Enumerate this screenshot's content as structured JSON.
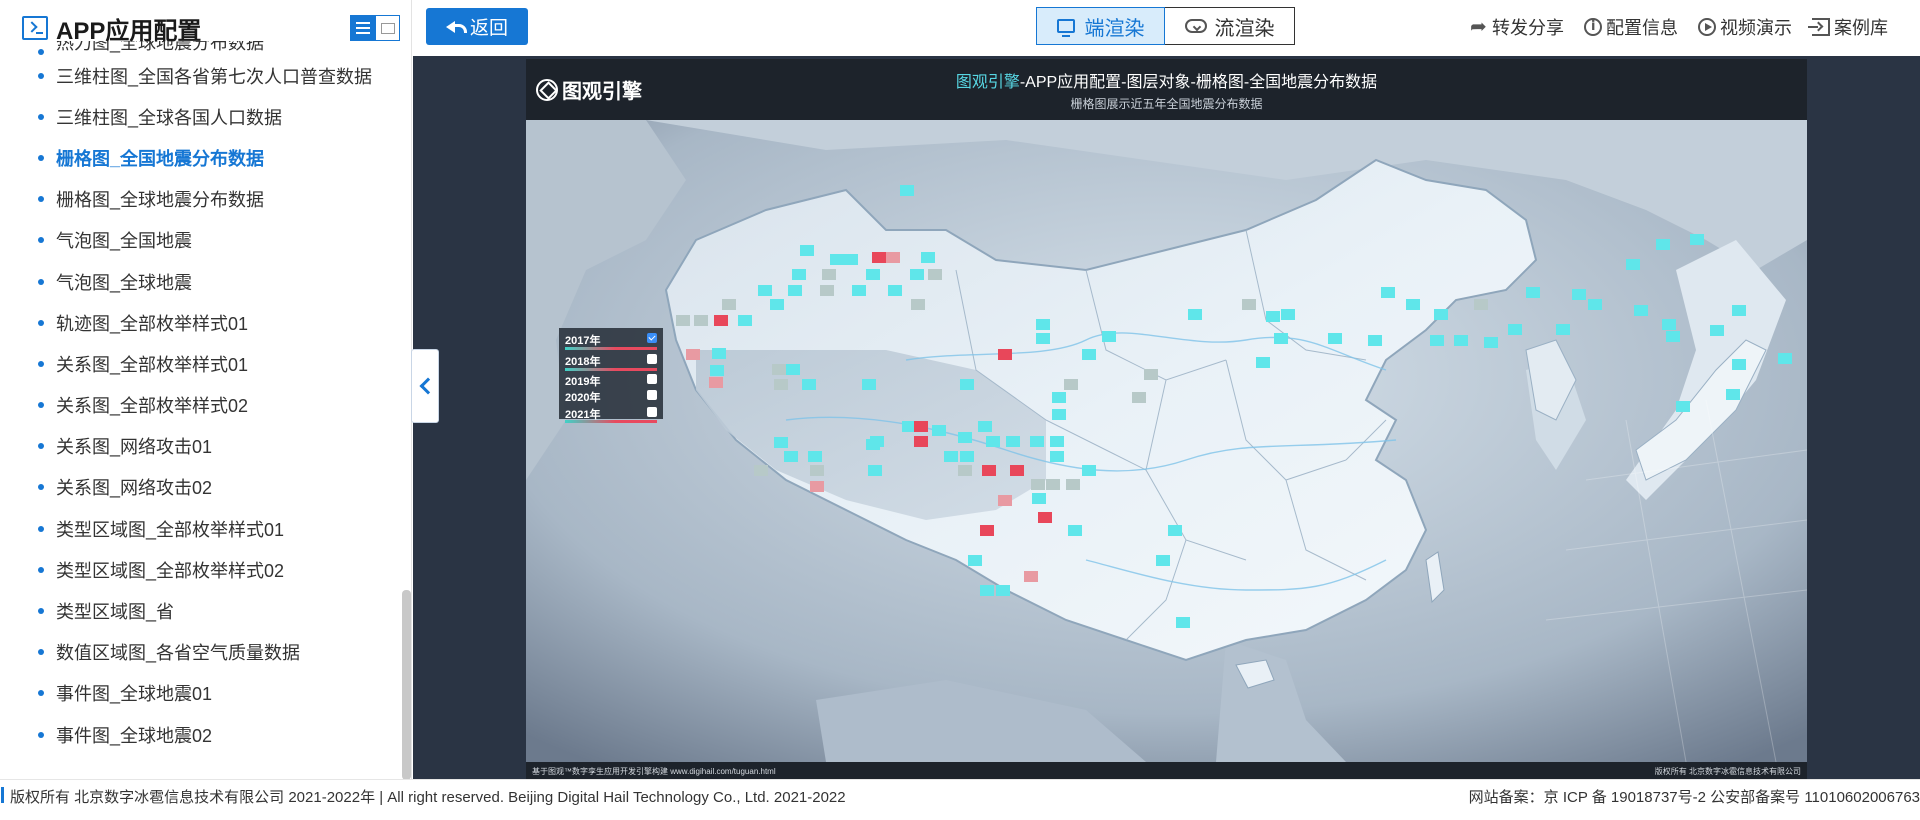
{
  "sidebar": {
    "title": "APP应用配置",
    "items": [
      {
        "label": "热力图_全球地震分布数据",
        "active": false
      },
      {
        "label": "三维柱图_全国各省第七次人口普查数据",
        "active": false
      },
      {
        "label": "三维柱图_全球各国人口数据",
        "active": false
      },
      {
        "label": "栅格图_全国地震分布数据",
        "active": true
      },
      {
        "label": "栅格图_全球地震分布数据",
        "active": false
      },
      {
        "label": "气泡图_全国地震",
        "active": false
      },
      {
        "label": "气泡图_全球地震",
        "active": false
      },
      {
        "label": "轨迹图_全部枚举样式01",
        "active": false
      },
      {
        "label": "关系图_全部枚举样式01",
        "active": false
      },
      {
        "label": "关系图_全部枚举样式02",
        "active": false
      },
      {
        "label": "关系图_网络攻击01",
        "active": false
      },
      {
        "label": "关系图_网络攻击02",
        "active": false
      },
      {
        "label": "类型区域图_全部枚举样式01",
        "active": false
      },
      {
        "label": "类型区域图_全部枚举样式02",
        "active": false
      },
      {
        "label": "类型区域图_省",
        "active": false
      },
      {
        "label": "数值区域图_各省空气质量数据",
        "active": false
      },
      {
        "label": "事件图_全球地震01",
        "active": false
      },
      {
        "label": "事件图_全球地震02",
        "active": false
      }
    ]
  },
  "topbar": {
    "back_label": "返回",
    "render_client": "端渲染",
    "render_stream": "流渲染",
    "actions": [
      {
        "label": "转发分享",
        "icon": "share-icon"
      },
      {
        "label": "配置信息",
        "icon": "info-icon"
      },
      {
        "label": "视频演示",
        "icon": "play-icon"
      },
      {
        "label": "案例库",
        "icon": "library-icon"
      }
    ]
  },
  "viewer": {
    "brand": "图观引擎",
    "title_highlight": "图观引擎",
    "title_rest": "-APP应用配置-图层对象-栅格图-全国地震分布数据",
    "subtitle": "栅格图展示近五年全国地震分布数据",
    "footer_left": "基于图观™数字孪生应用开发引擎构建 www.digihail.com/tuguan.html",
    "footer_right": "版权所有 北京数字冰雹信息技术有限公司",
    "legend": [
      {
        "label": "2017年",
        "checked": true
      },
      {
        "label": "2018年",
        "checked": false
      },
      {
        "label": "2019年",
        "checked": false
      },
      {
        "label": "2020年",
        "checked": false
      },
      {
        "label": "2021年",
        "checked": false
      }
    ],
    "colors": {
      "low": "#5fe6ea",
      "mid": "#b7c9c8",
      "high": "#e8475a",
      "mid_high": "#e89aa2"
    }
  },
  "footer": {
    "left": "版权所有 北京数字冰雹信息技术有限公司 2021-2022年 | All right reserved. Beijing Digital Hail Technology Co., Ltd. 2021-2022",
    "right": "网站备案：京 ICP 备 19018737号-2 公安部备案号 11010602006763"
  }
}
